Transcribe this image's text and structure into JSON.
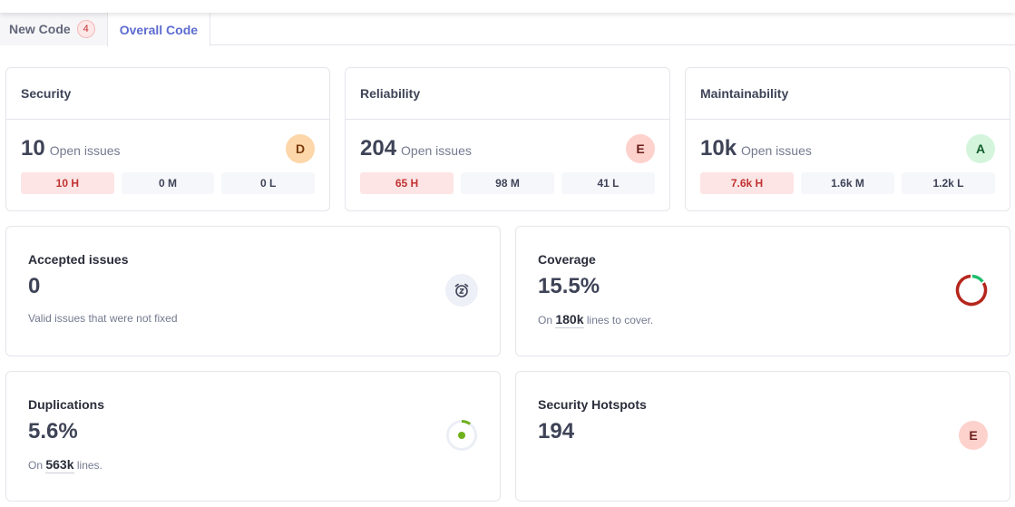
{
  "tabs": [
    {
      "label": "New Code",
      "badge": "4",
      "active": false
    },
    {
      "label": "Overall Code",
      "active": true
    }
  ],
  "issue_cards": [
    {
      "title": "Security",
      "count": "10",
      "count_label": "Open issues",
      "rating": "D",
      "rating_bg": "#fdd6a9",
      "rating_fg": "#7a3b0c",
      "high": "10 H",
      "medium": "0 M",
      "low": "0 L"
    },
    {
      "title": "Reliability",
      "count": "204",
      "count_label": "Open issues",
      "rating": "E",
      "rating_bg": "#fdd1cc",
      "rating_fg": "#6b1f1a",
      "high": "65 H",
      "medium": "98 M",
      "low": "41 L"
    },
    {
      "title": "Maintainability",
      "count": "10k",
      "count_label": "Open issues",
      "rating": "A",
      "rating_bg": "#d4f5dc",
      "rating_fg": "#125e2e",
      "high": "7.6k H",
      "medium": "1.6k M",
      "low": "1.2k L"
    }
  ],
  "accepted": {
    "title": "Accepted issues",
    "value": "0",
    "note": "Valid issues that were not fixed",
    "icon": "alarm-snooze-icon"
  },
  "coverage": {
    "title": "Coverage",
    "value": "15.5%",
    "note_prefix": "On",
    "lines": "180k",
    "note_suffix": "lines to cover.",
    "percent": 15.5,
    "colors": {
      "covered": "#1ebd6c",
      "uncovered": "#b5261c"
    }
  },
  "duplications": {
    "title": "Duplications",
    "value": "5.6%",
    "note_prefix": "On",
    "lines": "563k",
    "note_suffix": "lines.",
    "percent": 5.6,
    "colors": {
      "accent": "#6fb01d",
      "track": "#eceef5"
    }
  },
  "hotspots": {
    "title": "Security Hotspots",
    "value": "194",
    "rating": "E",
    "rating_bg": "#fdd1cc",
    "rating_fg": "#6b1f1a"
  }
}
